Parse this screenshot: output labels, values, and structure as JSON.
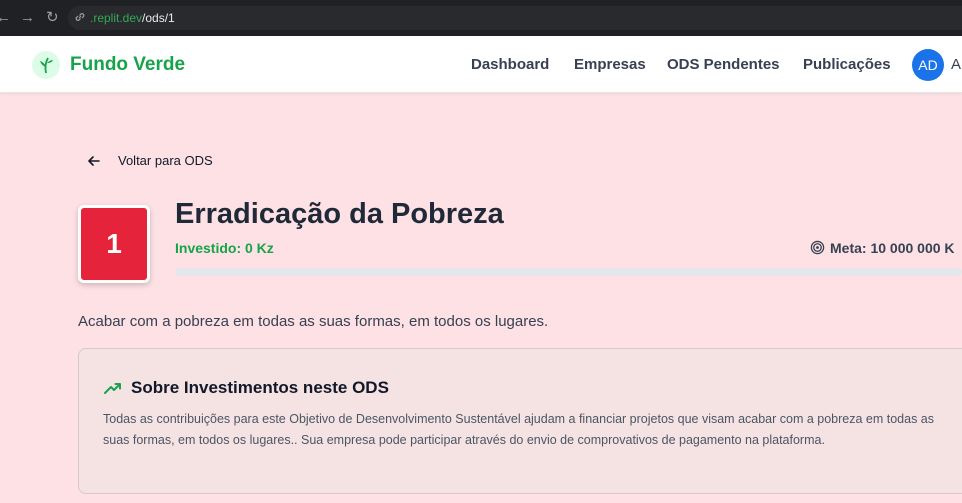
{
  "browser": {
    "url_domain": ".replit.dev",
    "url_path": "/ods/1"
  },
  "header": {
    "brand": "Fundo Verde",
    "nav": [
      {
        "label": "Dashboard"
      },
      {
        "label": "Empresas"
      },
      {
        "label": "ODS Pendentes"
      },
      {
        "label": "Publicações"
      }
    ],
    "avatar_initials": "AD",
    "avatar_name": "A"
  },
  "page": {
    "back_label": "Voltar para ODS",
    "ods_number": "1",
    "ods_color": "#e5243b",
    "title": "Erradicação da Pobreza",
    "invested": "Investido: 0 Kz",
    "goal": "Meta: 10 000 000 K",
    "progress_fraction": 0,
    "description": "Acabar com a pobreza em todas as suas formas, em todos os lugares.",
    "card": {
      "title": "Sobre Investimentos neste ODS",
      "body": "Todas as contribuições para este Objetivo de Desenvolvimento Sustentável ajudam a financiar projetos que visam acabar com a pobreza em todas as suas formas, em todos os lugares.. Sua empresa pode participar através do envio de comprovativos de pagamento na plataforma."
    }
  },
  "icons": [
    "back-nav-icon",
    "forward-nav-icon",
    "reload-icon",
    "link-icon",
    "leaf-logo-icon",
    "arrow-left-icon",
    "target-icon",
    "trending-up-icon"
  ],
  "colors": {
    "accent": "#16a34a",
    "background": "#fde1e4",
    "avatar": "#1a73e8"
  }
}
